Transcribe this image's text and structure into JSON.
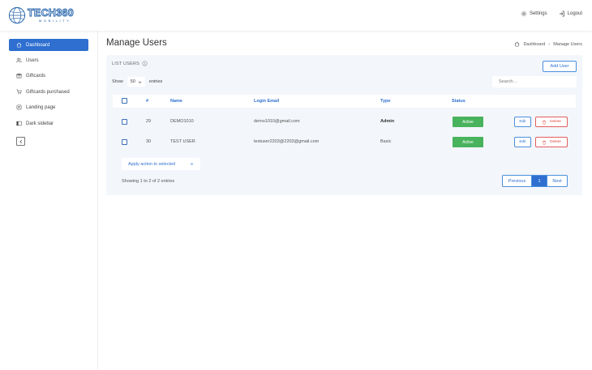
{
  "brand": {
    "name": "TECH360",
    "tagline": "MOBILITY"
  },
  "header": {
    "settings_label": "Settings",
    "logout_label": "Logout"
  },
  "sidebar": {
    "items": [
      {
        "label": "Dashboard",
        "icon": "home-icon",
        "active": true
      },
      {
        "label": "Users",
        "icon": "users-icon"
      },
      {
        "label": "Giftcards",
        "icon": "gift-icon"
      },
      {
        "label": "Giftcards purchased",
        "icon": "cart-icon"
      },
      {
        "label": "Landing page",
        "icon": "page-icon"
      },
      {
        "label": "Dark sidebar",
        "icon": "sidebar-icon"
      }
    ]
  },
  "page": {
    "title": "Manage Users",
    "breadcrumb": [
      "Dashboard",
      "Manage Users"
    ]
  },
  "card": {
    "title": "LIST USERS",
    "add_user_label": "Add User",
    "show_label": "Show",
    "page_length": "50",
    "entries_label": "entries",
    "search_placeholder": "Search..."
  },
  "table": {
    "columns": [
      "#",
      "Name",
      "Login Email",
      "Type",
      "Status"
    ],
    "rows": [
      {
        "id": "29",
        "name": "DEMO1010",
        "email": "demo1010@gmail.com",
        "type": "Admin",
        "status": "Active",
        "edit": "Edit",
        "delete": "Delete"
      },
      {
        "id": "30",
        "name": "TEST USER",
        "email": "testuser2203@2203@gmail.com",
        "type": "Basic",
        "status": "Active",
        "edit": "Edit",
        "delete": "Delete"
      }
    ]
  },
  "footer": {
    "bulk_action_label": "Apply action to selected",
    "info": "Showing 1 to 2 of 2 entries",
    "pagination": {
      "previous": "Previous",
      "current": "1",
      "next": "Next"
    }
  },
  "colors": {
    "primary": "#2e6fd0",
    "success": "#48b35c",
    "danger": "#e04848",
    "card_bg": "#f3f6fb"
  }
}
